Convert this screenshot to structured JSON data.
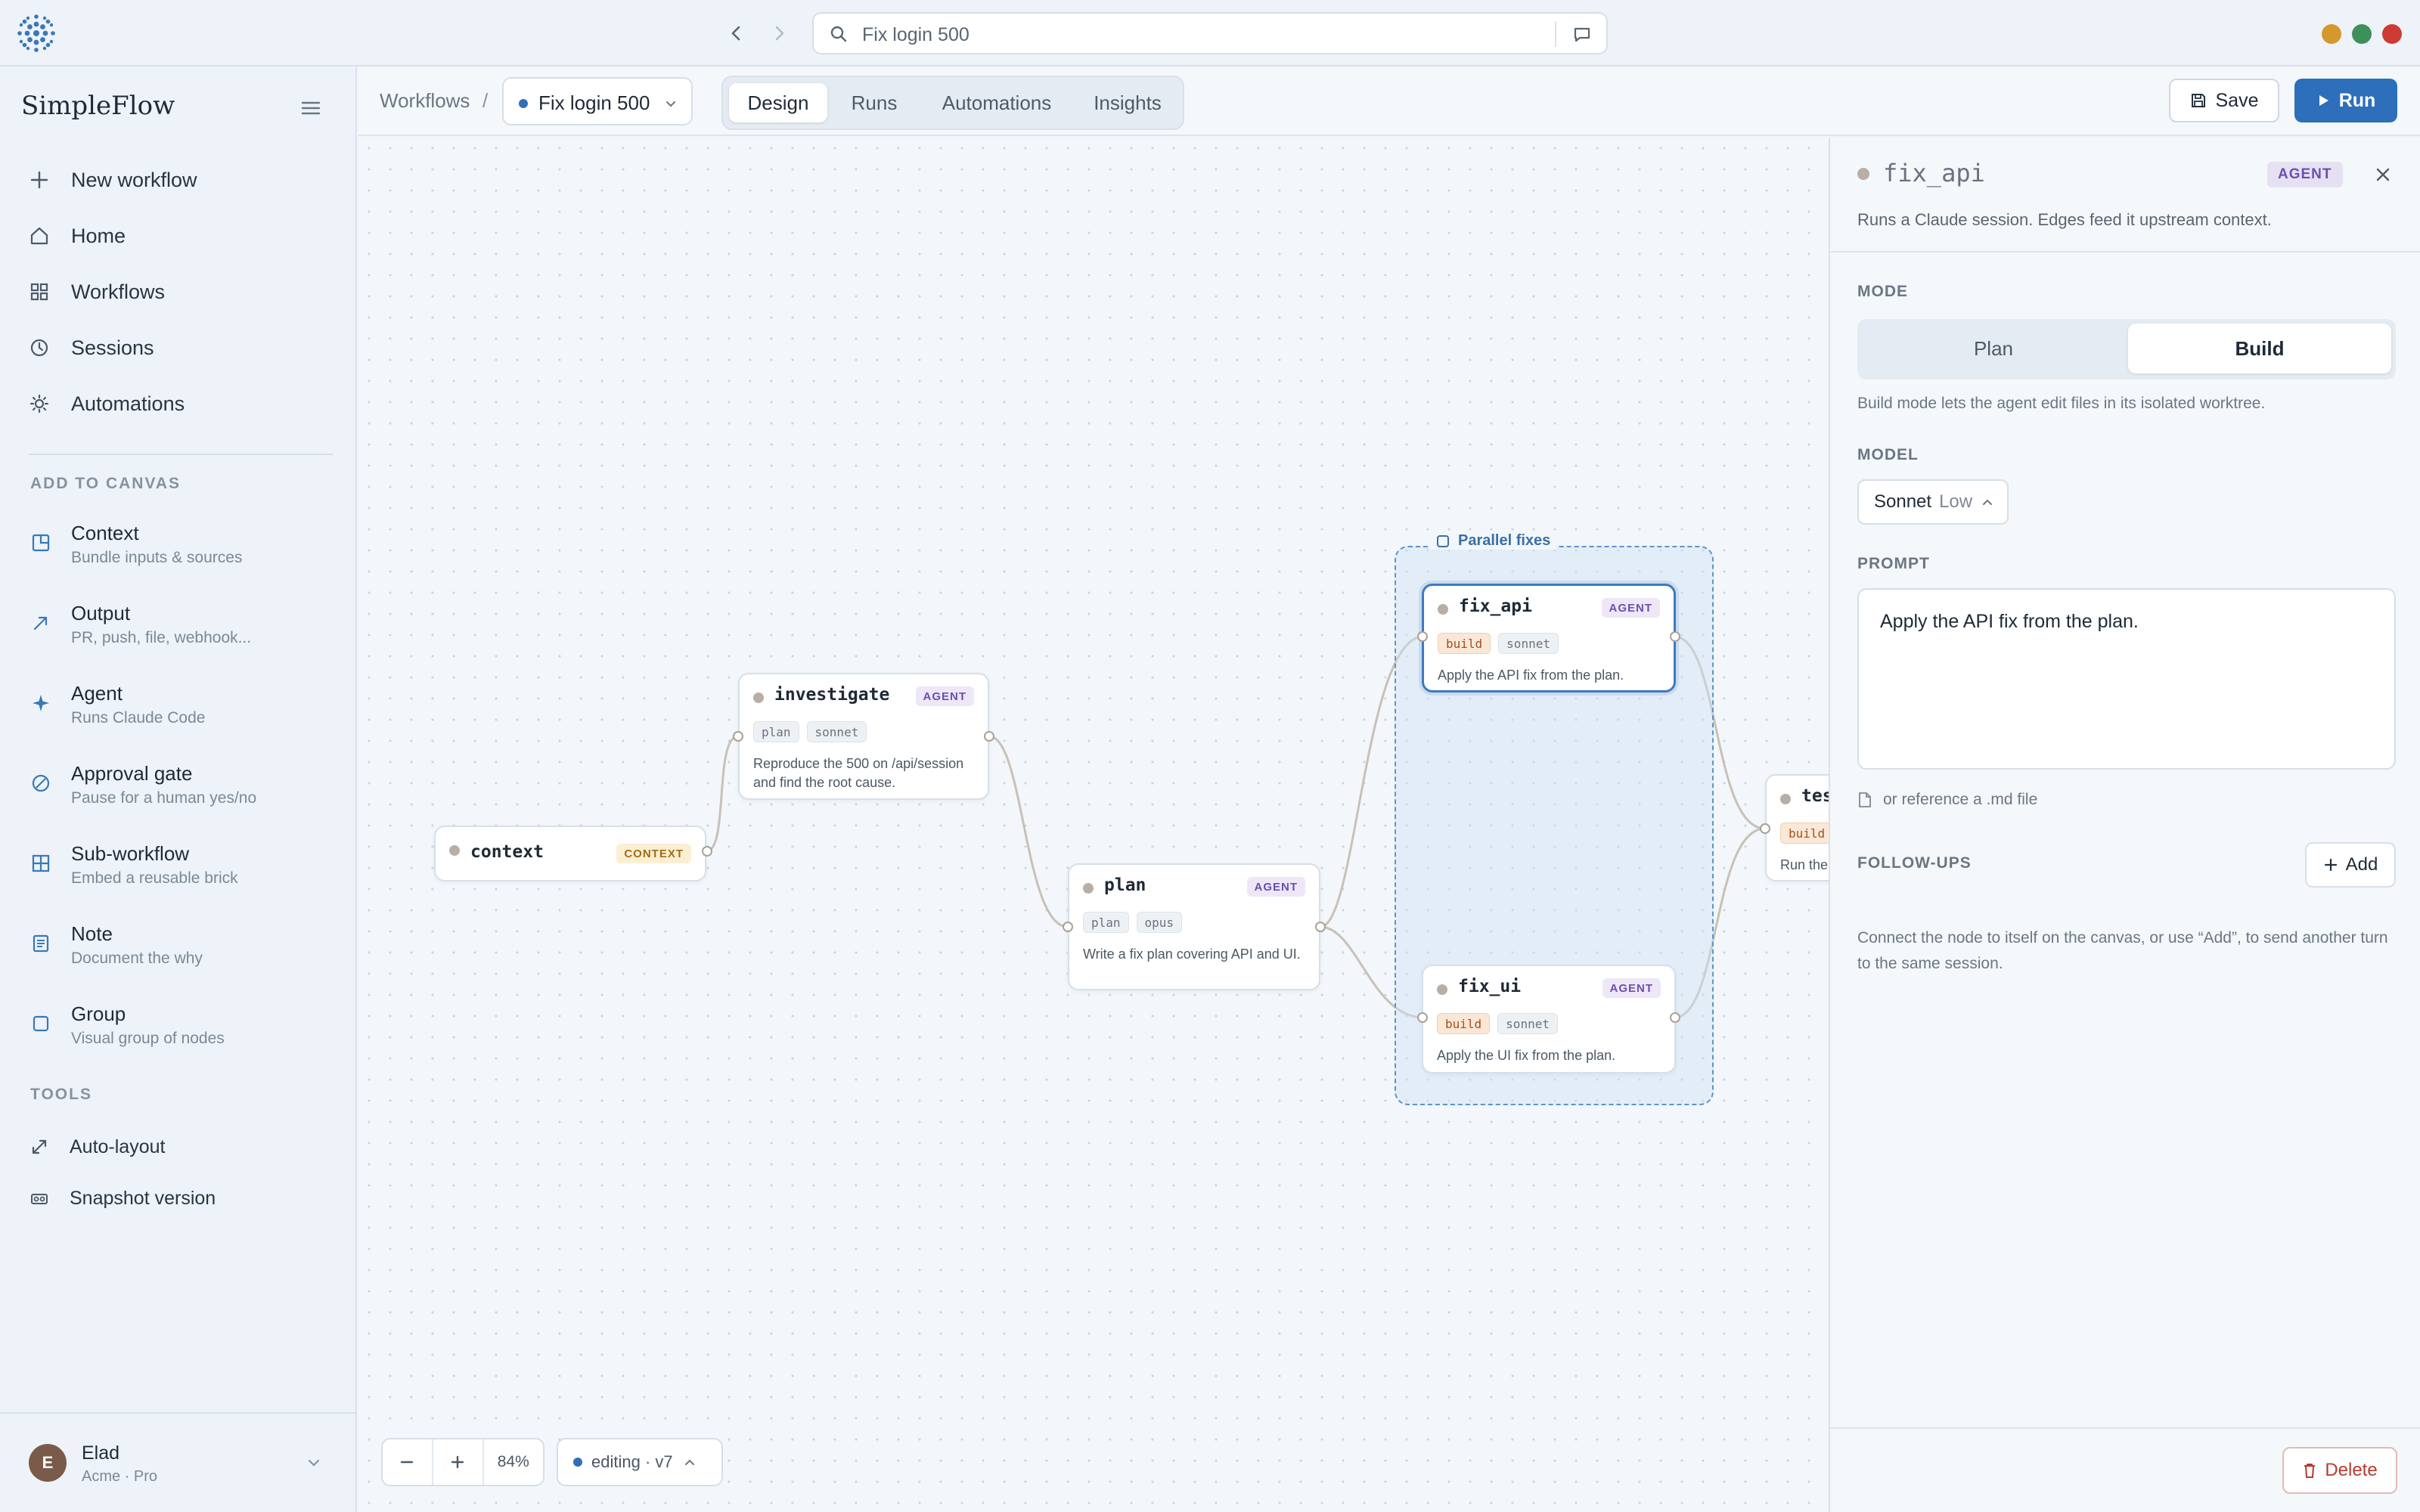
{
  "app": {
    "name": "SimpleFlow"
  },
  "browser": {
    "url_text": "Fix login 500",
    "icons": {
      "back": "chevron-left-icon",
      "forward": "chevron-right-icon",
      "search": "search-icon",
      "chat": "chat-icon"
    },
    "window_dots": [
      "#d4982c",
      "#3f8f5a",
      "#cc3c35"
    ]
  },
  "sidebar": {
    "nav": [
      {
        "label": "New workflow",
        "icon": "plus-icon"
      },
      {
        "label": "Home",
        "icon": "home-icon"
      },
      {
        "label": "Workflows",
        "icon": "grid-icon"
      },
      {
        "label": "Sessions",
        "icon": "clock-icon"
      },
      {
        "label": "Automations",
        "icon": "sun-icon"
      }
    ],
    "add_heading": "ADD TO CANVAS",
    "add_items": [
      {
        "title": "Context",
        "subtitle": "Bundle inputs & sources"
      },
      {
        "title": "Output",
        "subtitle": "PR, push, file, webhook..."
      },
      {
        "title": "Agent",
        "subtitle": "Runs Claude Code"
      },
      {
        "title": "Approval gate",
        "subtitle": "Pause for a human yes/no"
      },
      {
        "title": "Sub-workflow",
        "subtitle": "Embed a reusable brick"
      },
      {
        "title": "Note",
        "subtitle": "Document the why"
      },
      {
        "title": "Group",
        "subtitle": "Visual group of nodes"
      }
    ],
    "tools_heading": "TOOLS",
    "tools": [
      {
        "label": "Auto-layout"
      },
      {
        "label": "Snapshot version"
      }
    ],
    "user": {
      "initial": "E",
      "name": "Elad",
      "plan": "Acme · Pro"
    }
  },
  "topbar": {
    "breadcrumb": "Workflows",
    "separator": "/",
    "workflow_name": "Fix login 500",
    "tabs": [
      "Design",
      "Runs",
      "Automations",
      "Insights"
    ],
    "active_tab": "Design",
    "save_label": "Save",
    "run_label": "Run"
  },
  "canvas": {
    "group_label": "Parallel fixes",
    "nodes": {
      "context": {
        "title": "context",
        "badge": "CONTEXT"
      },
      "investigate": {
        "title": "investigate",
        "badge": "AGENT",
        "tags": [
          "plan",
          "sonnet"
        ],
        "desc": "Reproduce the 500 on /api/session and find the root cause."
      },
      "plan": {
        "title": "plan",
        "badge": "AGENT",
        "tags": [
          "plan",
          "opus"
        ],
        "desc": "Write a fix plan covering API and UI."
      },
      "fix_api": {
        "title": "fix_api",
        "badge": "AGENT",
        "tags": [
          "build",
          "sonnet"
        ],
        "desc": "Apply the API fix from the plan."
      },
      "fix_ui": {
        "title": "fix_ui",
        "badge": "AGENT",
        "tags": [
          "build",
          "sonnet"
        ],
        "desc": "Apply the UI fix from the plan."
      },
      "test": {
        "title": "tes",
        "tag": "build",
        "desc": "Run the"
      }
    },
    "zoom": "84%",
    "version": "editing · v7"
  },
  "panel": {
    "title": "fix_api",
    "badge": "AGENT",
    "subtitle": "Runs a Claude session. Edges feed it upstream context.",
    "mode_label": "MODE",
    "mode_options": [
      "Plan",
      "Build"
    ],
    "mode_selected": "Build",
    "mode_help": "Build mode lets the agent edit files in its isolated worktree.",
    "model_label": "MODEL",
    "model_name": "Sonnet",
    "model_effort": "Low",
    "prompt_label": "PROMPT",
    "prompt_value": "Apply the API fix from the plan.",
    "md_reference": "or reference a .md file",
    "followups_label": "FOLLOW-UPS",
    "add_label": "Add",
    "followups_help": "Connect the node to itself on the canvas, or use “Add”, to send another turn to the same session.",
    "delete_label": "Delete"
  }
}
